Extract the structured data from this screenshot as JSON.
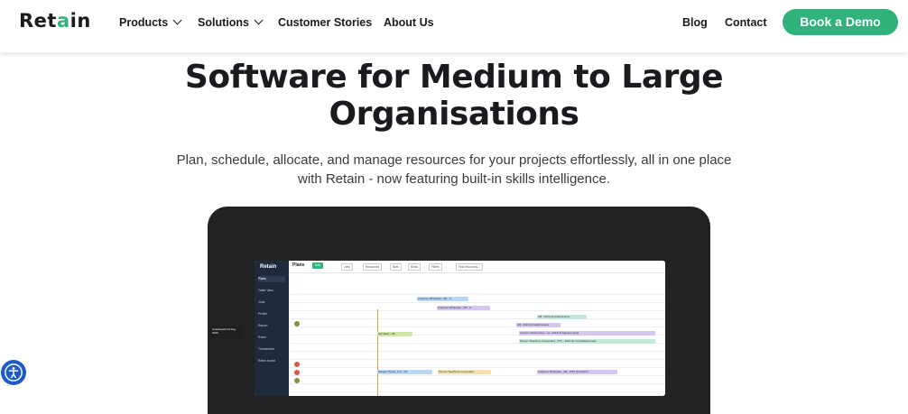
{
  "nav": {
    "logo": "Retain",
    "products": "Products",
    "solutions": "Solutions",
    "customer_stories": "Customer Stories",
    "about_us": "About Us",
    "blog": "Blog",
    "contact": "Contact",
    "book_demo": "Book a Demo"
  },
  "hero": {
    "title_line1": "Software for Medium to Large",
    "title_line2": "Organisations",
    "subtitle_line1": "Plan, schedule, allocate, and manage resources for your projects effortlessly, all in one place",
    "subtitle_line2": "with Retain - now featuring built-in skills intelligence."
  },
  "app_preview": {
    "brand": "Retain",
    "page_title": "Plans",
    "add_label": "Add",
    "sidebar": [
      "Plans",
      "Table View",
      "Jobs",
      "Profile",
      "Report",
      "Roles",
      "Timesheets",
      "Rates board"
    ],
    "toolbar_pills": [
      "Jobs",
      "Resources",
      "Bars",
      "Show",
      "Filters",
      "Find resources..."
    ],
    "tooltip": "Unassigned 14 Aug 2023",
    "bars": [
      "Anderson Wholesale - AM - C...",
      "Anderson Wholesale - AM - 2...",
      "AM - 2023 Q1 Audit Finance",
      "AM - 2023 Q1 Audit Finance",
      "Contoso Infrastructure - 11 - 2023 H1 Statutory Audit",
      "Pioneer Telephone Cooperative - PTC - 2023 Q1 Consolidated audit",
      "City Bank - CB",
      "Paragon Sports, LLC - PS",
      "Pioneer Telephone Cooperative",
      "Anderson Wholesale - AM - 2023 Q2 Audit Fi..."
    ]
  },
  "colors": {
    "accent": "#2fb37a",
    "device": "#222224",
    "sidebar": "#1f2a3d",
    "a11y": "#1f5ac9"
  },
  "icons": [
    "chevron-down-icon",
    "accessibility-icon"
  ]
}
